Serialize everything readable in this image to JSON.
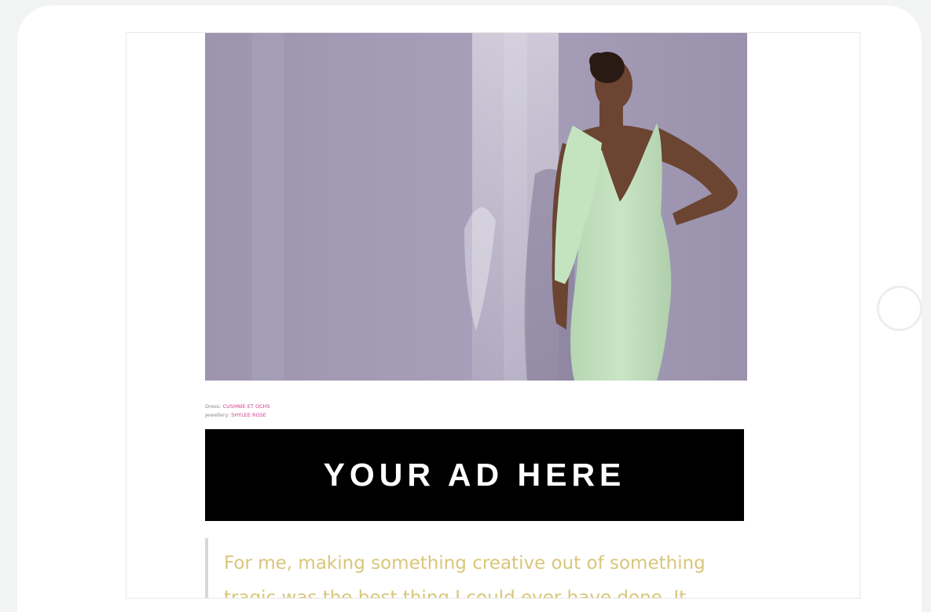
{
  "article": {
    "credits": [
      {
        "label": "Dress:",
        "brand": "CUSHNIE ET OCHS"
      },
      {
        "label": "Jewellery:",
        "brand": "SHYLEE ROSE"
      }
    ],
    "pullquote": "For me, making something creative out of something tragic was the best thing I could ever have done. It"
  },
  "ad": {
    "label": "YOUR AD HERE"
  },
  "colors": {
    "credit_brand": "#d63a8e",
    "pullquote_text": "#d9c67a",
    "ad_background": "#000000",
    "photo_background": "#9a91ad",
    "dress": "#c5e2c1"
  }
}
